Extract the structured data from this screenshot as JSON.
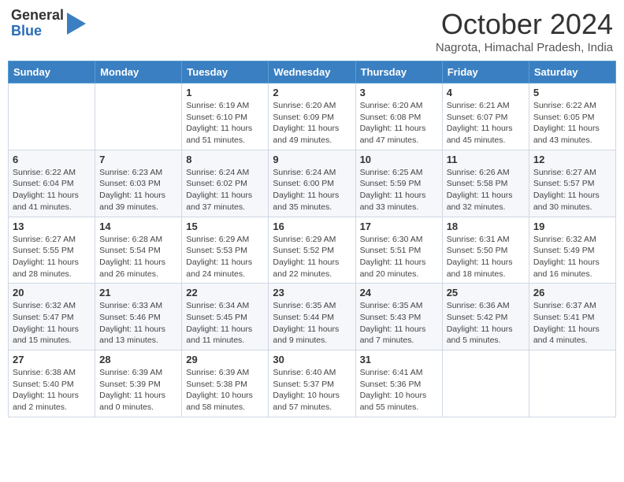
{
  "logo": {
    "general": "General",
    "blue": "Blue"
  },
  "title": "October 2024",
  "subtitle": "Nagrota, Himachal Pradesh, India",
  "days_of_week": [
    "Sunday",
    "Monday",
    "Tuesday",
    "Wednesday",
    "Thursday",
    "Friday",
    "Saturday"
  ],
  "weeks": [
    [
      {
        "day": "",
        "sunrise": "",
        "sunset": "",
        "daylight": ""
      },
      {
        "day": "",
        "sunrise": "",
        "sunset": "",
        "daylight": ""
      },
      {
        "day": "1",
        "sunrise": "Sunrise: 6:19 AM",
        "sunset": "Sunset: 6:10 PM",
        "daylight": "Daylight: 11 hours and 51 minutes."
      },
      {
        "day": "2",
        "sunrise": "Sunrise: 6:20 AM",
        "sunset": "Sunset: 6:09 PM",
        "daylight": "Daylight: 11 hours and 49 minutes."
      },
      {
        "day": "3",
        "sunrise": "Sunrise: 6:20 AM",
        "sunset": "Sunset: 6:08 PM",
        "daylight": "Daylight: 11 hours and 47 minutes."
      },
      {
        "day": "4",
        "sunrise": "Sunrise: 6:21 AM",
        "sunset": "Sunset: 6:07 PM",
        "daylight": "Daylight: 11 hours and 45 minutes."
      },
      {
        "day": "5",
        "sunrise": "Sunrise: 6:22 AM",
        "sunset": "Sunset: 6:05 PM",
        "daylight": "Daylight: 11 hours and 43 minutes."
      }
    ],
    [
      {
        "day": "6",
        "sunrise": "Sunrise: 6:22 AM",
        "sunset": "Sunset: 6:04 PM",
        "daylight": "Daylight: 11 hours and 41 minutes."
      },
      {
        "day": "7",
        "sunrise": "Sunrise: 6:23 AM",
        "sunset": "Sunset: 6:03 PM",
        "daylight": "Daylight: 11 hours and 39 minutes."
      },
      {
        "day": "8",
        "sunrise": "Sunrise: 6:24 AM",
        "sunset": "Sunset: 6:02 PM",
        "daylight": "Daylight: 11 hours and 37 minutes."
      },
      {
        "day": "9",
        "sunrise": "Sunrise: 6:24 AM",
        "sunset": "Sunset: 6:00 PM",
        "daylight": "Daylight: 11 hours and 35 minutes."
      },
      {
        "day": "10",
        "sunrise": "Sunrise: 6:25 AM",
        "sunset": "Sunset: 5:59 PM",
        "daylight": "Daylight: 11 hours and 33 minutes."
      },
      {
        "day": "11",
        "sunrise": "Sunrise: 6:26 AM",
        "sunset": "Sunset: 5:58 PM",
        "daylight": "Daylight: 11 hours and 32 minutes."
      },
      {
        "day": "12",
        "sunrise": "Sunrise: 6:27 AM",
        "sunset": "Sunset: 5:57 PM",
        "daylight": "Daylight: 11 hours and 30 minutes."
      }
    ],
    [
      {
        "day": "13",
        "sunrise": "Sunrise: 6:27 AM",
        "sunset": "Sunset: 5:55 PM",
        "daylight": "Daylight: 11 hours and 28 minutes."
      },
      {
        "day": "14",
        "sunrise": "Sunrise: 6:28 AM",
        "sunset": "Sunset: 5:54 PM",
        "daylight": "Daylight: 11 hours and 26 minutes."
      },
      {
        "day": "15",
        "sunrise": "Sunrise: 6:29 AM",
        "sunset": "Sunset: 5:53 PM",
        "daylight": "Daylight: 11 hours and 24 minutes."
      },
      {
        "day": "16",
        "sunrise": "Sunrise: 6:29 AM",
        "sunset": "Sunset: 5:52 PM",
        "daylight": "Daylight: 11 hours and 22 minutes."
      },
      {
        "day": "17",
        "sunrise": "Sunrise: 6:30 AM",
        "sunset": "Sunset: 5:51 PM",
        "daylight": "Daylight: 11 hours and 20 minutes."
      },
      {
        "day": "18",
        "sunrise": "Sunrise: 6:31 AM",
        "sunset": "Sunset: 5:50 PM",
        "daylight": "Daylight: 11 hours and 18 minutes."
      },
      {
        "day": "19",
        "sunrise": "Sunrise: 6:32 AM",
        "sunset": "Sunset: 5:49 PM",
        "daylight": "Daylight: 11 hours and 16 minutes."
      }
    ],
    [
      {
        "day": "20",
        "sunrise": "Sunrise: 6:32 AM",
        "sunset": "Sunset: 5:47 PM",
        "daylight": "Daylight: 11 hours and 15 minutes."
      },
      {
        "day": "21",
        "sunrise": "Sunrise: 6:33 AM",
        "sunset": "Sunset: 5:46 PM",
        "daylight": "Daylight: 11 hours and 13 minutes."
      },
      {
        "day": "22",
        "sunrise": "Sunrise: 6:34 AM",
        "sunset": "Sunset: 5:45 PM",
        "daylight": "Daylight: 11 hours and 11 minutes."
      },
      {
        "day": "23",
        "sunrise": "Sunrise: 6:35 AM",
        "sunset": "Sunset: 5:44 PM",
        "daylight": "Daylight: 11 hours and 9 minutes."
      },
      {
        "day": "24",
        "sunrise": "Sunrise: 6:35 AM",
        "sunset": "Sunset: 5:43 PM",
        "daylight": "Daylight: 11 hours and 7 minutes."
      },
      {
        "day": "25",
        "sunrise": "Sunrise: 6:36 AM",
        "sunset": "Sunset: 5:42 PM",
        "daylight": "Daylight: 11 hours and 5 minutes."
      },
      {
        "day": "26",
        "sunrise": "Sunrise: 6:37 AM",
        "sunset": "Sunset: 5:41 PM",
        "daylight": "Daylight: 11 hours and 4 minutes."
      }
    ],
    [
      {
        "day": "27",
        "sunrise": "Sunrise: 6:38 AM",
        "sunset": "Sunset: 5:40 PM",
        "daylight": "Daylight: 11 hours and 2 minutes."
      },
      {
        "day": "28",
        "sunrise": "Sunrise: 6:39 AM",
        "sunset": "Sunset: 5:39 PM",
        "daylight": "Daylight: 11 hours and 0 minutes."
      },
      {
        "day": "29",
        "sunrise": "Sunrise: 6:39 AM",
        "sunset": "Sunset: 5:38 PM",
        "daylight": "Daylight: 10 hours and 58 minutes."
      },
      {
        "day": "30",
        "sunrise": "Sunrise: 6:40 AM",
        "sunset": "Sunset: 5:37 PM",
        "daylight": "Daylight: 10 hours and 57 minutes."
      },
      {
        "day": "31",
        "sunrise": "Sunrise: 6:41 AM",
        "sunset": "Sunset: 5:36 PM",
        "daylight": "Daylight: 10 hours and 55 minutes."
      },
      {
        "day": "",
        "sunrise": "",
        "sunset": "",
        "daylight": ""
      },
      {
        "day": "",
        "sunrise": "",
        "sunset": "",
        "daylight": ""
      }
    ]
  ]
}
